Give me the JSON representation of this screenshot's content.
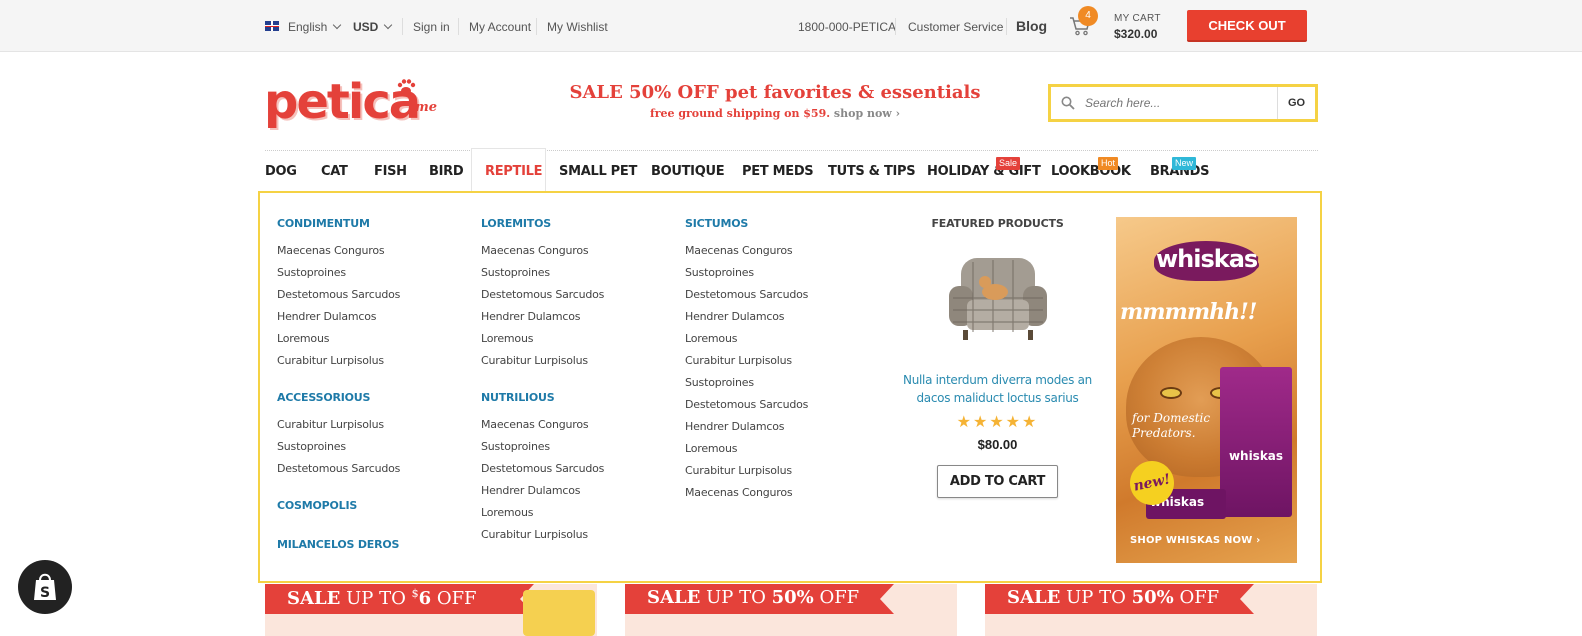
{
  "topbar": {
    "language": "English",
    "currency": "USD",
    "links": [
      "Sign in",
      "My Account",
      "My Wishlist"
    ],
    "phone": "1800-000-PETICA",
    "customer_service": "Customer Service",
    "blog": "Blog",
    "cart_count": "4",
    "cart_label": "MY CART",
    "cart_total": "$320.00",
    "checkout": "CHECK OUT"
  },
  "header": {
    "logo": "petica",
    "logo_suffix": "me",
    "sale_headline": "SALE 50% OFF pet favorites & essentials",
    "sale_sub": "free ground shipping on $59.",
    "shop_now": "shop now",
    "search_placeholder": "Search here...",
    "search_button": "GO"
  },
  "nav": {
    "items": [
      {
        "label": "DOG"
      },
      {
        "label": "CAT"
      },
      {
        "label": "FISH"
      },
      {
        "label": "BIRD"
      },
      {
        "label": "REPTILE",
        "active": true
      },
      {
        "label": "SMALL PET"
      },
      {
        "label": "BOUTIQUE"
      },
      {
        "label": "PET MEDS"
      },
      {
        "label": "TUTS & TIPS"
      },
      {
        "label": "HOLIDAY & GIFT",
        "tag": "Sale"
      },
      {
        "label": "LOOKBOOK",
        "tag": "Hot"
      },
      {
        "label": "BRANDS",
        "tag": "New"
      }
    ]
  },
  "mega": {
    "col1": [
      {
        "head": "CONDIMENTUM",
        "links": [
          "Maecenas Conguros",
          "Sustoproines",
          "Destetomous Sarcudos",
          "Hendrer Dulamcos",
          "Loremous",
          "Curabitur Lurpisolus"
        ]
      },
      {
        "head": "ACCESSORIOUS",
        "links": [
          "Curabitur Lurpisolus",
          "Sustoproines",
          "Destetomous Sarcudos"
        ]
      },
      {
        "head": "COSMOPOLIS",
        "links": []
      },
      {
        "head": "MILANCELOS DEROS",
        "links": []
      }
    ],
    "col2": [
      {
        "head": "LOREMITOS",
        "links": [
          "Maecenas Conguros",
          "Sustoproines",
          "Destetomous Sarcudos",
          "Hendrer Dulamcos",
          "Loremous",
          "Curabitur Lurpisolus"
        ]
      },
      {
        "head": "NUTRILIOUS",
        "links": [
          "Maecenas Conguros",
          "Sustoproines",
          "Destetomous Sarcudos",
          "Hendrer Dulamcos",
          "Loremous",
          "Curabitur Lurpisolus"
        ]
      }
    ],
    "col3": [
      {
        "head": "SICTUMOS",
        "links": [
          "Maecenas Conguros",
          "Sustoproines",
          "Destetomous Sarcudos",
          "Hendrer Dulamcos",
          "Loremous",
          "Curabitur Lurpisolus",
          "Sustoproines",
          "Destetomous Sarcudos",
          "Hendrer Dulamcos",
          "Loremous",
          "Curabitur Lurpisolus",
          "Maecenas Conguros"
        ]
      }
    ],
    "featured": {
      "title": "FEATURED PRODUCTS",
      "product_name": "Nulla interdum diverra modes an dacos maliduct loctus sarius",
      "rating": 5,
      "price": "$80.00",
      "add_to_cart": "ADD TO CART"
    },
    "banner": {
      "brand": "whiskas",
      "script": "mmmmhh!!",
      "tagline": "for Domestic Predators.",
      "new_badge": "new!",
      "shop_now": "SHOP WHISKAS NOW"
    }
  },
  "promos": [
    {
      "lead": "SALE",
      "text": " UP TO ",
      "sup": "$",
      "amount": "6",
      "tail": " OFF"
    },
    {
      "lead": "SALE",
      "text": " UP TO ",
      "sup": "",
      "amount": "50%",
      "tail": " OFF"
    },
    {
      "lead": "SALE",
      "text": " UP TO ",
      "sup": "",
      "amount": "50%",
      "tail": " OFF"
    }
  ],
  "colors": {
    "brand_red": "#e4413a",
    "accent_yellow": "#f5d244",
    "link_blue": "#1e7aa8"
  }
}
